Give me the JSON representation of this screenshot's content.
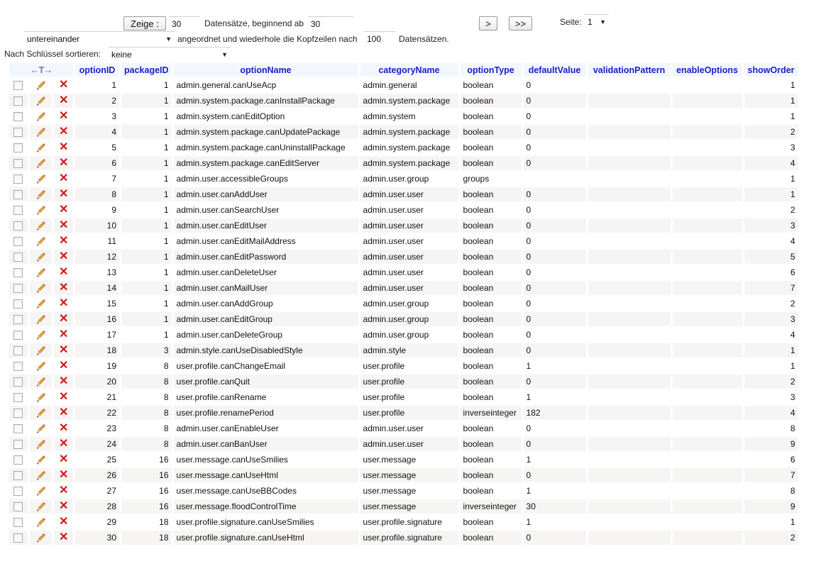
{
  "nav": {
    "show_button": "Zeige :",
    "rows_value": "30",
    "rows_label": "Datensätze, beginnend ab",
    "start_value": "30",
    "next_button": ">",
    "last_button": ">>",
    "page_label": "Seite:",
    "page_value": "1",
    "mode_value": "untereinander",
    "mode_label": "angeordnet und wiederhole die Kopfzeilen nach",
    "repeat_value": "100",
    "repeat_label": "Datensätzen.",
    "sort_label": "Nach Schlüssel sortieren:",
    "sort_value": "keine"
  },
  "table": {
    "arrows_header": "←T→",
    "columns": [
      "optionID",
      "packageID",
      "optionName",
      "categoryName",
      "optionType",
      "defaultValue",
      "validationPattern",
      "enableOptions",
      "showOrder"
    ],
    "rows": [
      {
        "id": "1",
        "pkg": "1",
        "name": "admin.general.canUseAcp",
        "cat": "admin.general",
        "type": "boolean",
        "def": "0",
        "order": "1"
      },
      {
        "id": "2",
        "pkg": "1",
        "name": "admin.system.package.canInstallPackage",
        "cat": "admin.system.package",
        "type": "boolean",
        "def": "0",
        "order": "1"
      },
      {
        "id": "3",
        "pkg": "1",
        "name": "admin.system.canEditOption",
        "cat": "admin.system",
        "type": "boolean",
        "def": "0",
        "order": "1"
      },
      {
        "id": "4",
        "pkg": "1",
        "name": "admin.system.package.canUpdatePackage",
        "cat": "admin.system.package",
        "type": "boolean",
        "def": "0",
        "order": "2"
      },
      {
        "id": "5",
        "pkg": "1",
        "name": "admin.system.package.canUninstallPackage",
        "cat": "admin.system.package",
        "type": "boolean",
        "def": "0",
        "order": "3"
      },
      {
        "id": "6",
        "pkg": "1",
        "name": "admin.system.package.canEditServer",
        "cat": "admin.system.package",
        "type": "boolean",
        "def": "0",
        "order": "4"
      },
      {
        "id": "7",
        "pkg": "1",
        "name": "admin.user.accessibleGroups",
        "cat": "admin.user.group",
        "type": "groups",
        "def": "",
        "order": "1"
      },
      {
        "id": "8",
        "pkg": "1",
        "name": "admin.user.canAddUser",
        "cat": "admin.user.user",
        "type": "boolean",
        "def": "0",
        "order": "1"
      },
      {
        "id": "9",
        "pkg": "1",
        "name": "admin.user.canSearchUser",
        "cat": "admin.user.user",
        "type": "boolean",
        "def": "0",
        "order": "2"
      },
      {
        "id": "10",
        "pkg": "1",
        "name": "admin.user.canEditUser",
        "cat": "admin.user.user",
        "type": "boolean",
        "def": "0",
        "order": "3"
      },
      {
        "id": "11",
        "pkg": "1",
        "name": "admin.user.canEditMailAddress",
        "cat": "admin.user.user",
        "type": "boolean",
        "def": "0",
        "order": "4"
      },
      {
        "id": "12",
        "pkg": "1",
        "name": "admin.user.canEditPassword",
        "cat": "admin.user.user",
        "type": "boolean",
        "def": "0",
        "order": "5"
      },
      {
        "id": "13",
        "pkg": "1",
        "name": "admin.user.canDeleteUser",
        "cat": "admin.user.user",
        "type": "boolean",
        "def": "0",
        "order": "6"
      },
      {
        "id": "14",
        "pkg": "1",
        "name": "admin.user.canMailUser",
        "cat": "admin.user.user",
        "type": "boolean",
        "def": "0",
        "order": "7"
      },
      {
        "id": "15",
        "pkg": "1",
        "name": "admin.user.canAddGroup",
        "cat": "admin.user.group",
        "type": "boolean",
        "def": "0",
        "order": "2"
      },
      {
        "id": "16",
        "pkg": "1",
        "name": "admin.user.canEditGroup",
        "cat": "admin.user.group",
        "type": "boolean",
        "def": "0",
        "order": "3"
      },
      {
        "id": "17",
        "pkg": "1",
        "name": "admin.user.canDeleteGroup",
        "cat": "admin.user.group",
        "type": "boolean",
        "def": "0",
        "order": "4"
      },
      {
        "id": "18",
        "pkg": "3",
        "name": "admin.style.canUseDisabledStyle",
        "cat": "admin.style",
        "type": "boolean",
        "def": "0",
        "order": "1"
      },
      {
        "id": "19",
        "pkg": "8",
        "name": "user.profile.canChangeEmail",
        "cat": "user.profile",
        "type": "boolean",
        "def": "1",
        "order": "1"
      },
      {
        "id": "20",
        "pkg": "8",
        "name": "user.profile.canQuit",
        "cat": "user.profile",
        "type": "boolean",
        "def": "0",
        "order": "2"
      },
      {
        "id": "21",
        "pkg": "8",
        "name": "user.profile.canRename",
        "cat": "user.profile",
        "type": "boolean",
        "def": "1",
        "order": "3"
      },
      {
        "id": "22",
        "pkg": "8",
        "name": "user.profile.renamePeriod",
        "cat": "user.profile",
        "type": "inverseinteger",
        "def": "182",
        "order": "4"
      },
      {
        "id": "23",
        "pkg": "8",
        "name": "admin.user.canEnableUser",
        "cat": "admin.user.user",
        "type": "boolean",
        "def": "0",
        "order": "8"
      },
      {
        "id": "24",
        "pkg": "8",
        "name": "admin.user.canBanUser",
        "cat": "admin.user.user",
        "type": "boolean",
        "def": "0",
        "order": "9"
      },
      {
        "id": "25",
        "pkg": "16",
        "name": "user.message.canUseSmilies",
        "cat": "user.message",
        "type": "boolean",
        "def": "1",
        "order": "6"
      },
      {
        "id": "26",
        "pkg": "16",
        "name": "user.message.canUseHtml",
        "cat": "user.message",
        "type": "boolean",
        "def": "0",
        "order": "7"
      },
      {
        "id": "27",
        "pkg": "16",
        "name": "user.message.canUseBBCodes",
        "cat": "user.message",
        "type": "boolean",
        "def": "1",
        "order": "8"
      },
      {
        "id": "28",
        "pkg": "16",
        "name": "user.message.floodControlTime",
        "cat": "user.message",
        "type": "inverseinteger",
        "def": "30",
        "order": "9"
      },
      {
        "id": "29",
        "pkg": "18",
        "name": "user.profile.signature.canUseSmilies",
        "cat": "user.profile.signature",
        "type": "boolean",
        "def": "1",
        "order": "1"
      },
      {
        "id": "30",
        "pkg": "18",
        "name": "user.profile.signature.canUseHtml",
        "cat": "user.profile.signature",
        "type": "boolean",
        "def": "0",
        "order": "2"
      }
    ]
  },
  "colors": {
    "header_text": "#1b1ec8",
    "header_bg": "#f2f6fd",
    "row_alt_bg": "#f7f4f4",
    "delete_icon": "#d0181b"
  }
}
